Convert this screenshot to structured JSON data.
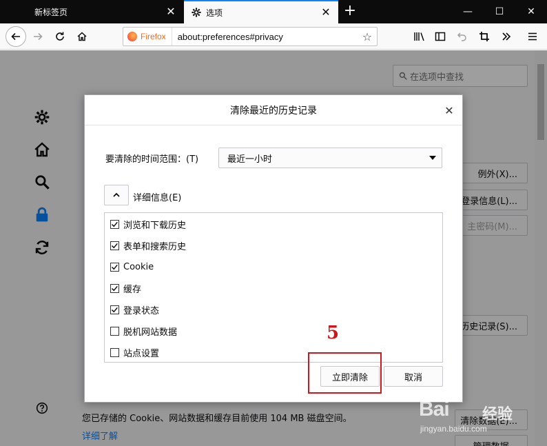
{
  "tabs": [
    {
      "title": "新标签页",
      "close": "✕"
    },
    {
      "title": "选项",
      "close": "✕"
    }
  ],
  "window_controls": {
    "minimize": "—",
    "maximize": "☐",
    "close": "✕"
  },
  "newtab": "+",
  "urlbar": {
    "identity": "Firefox",
    "url": "about:preferences#privacy"
  },
  "page": {
    "search_placeholder": "在选项中查找",
    "buttons": [
      "例外(X)...",
      "登录信息(L)...",
      "主密码(M)...",
      "历史记录(S)...",
      "清除数据(E)...",
      "管理数据..."
    ],
    "storage_text": "您已存储的 Cookie、网站数据和缓存目前使用 104 MB 磁盘空间。",
    "learn_more": "详细了解"
  },
  "dialog": {
    "title": "清除最近的历史记录",
    "close": "✕",
    "range_label": "要清除的时间范围：(T)",
    "range_value": "最近一小时",
    "details_label": "详细信息(E)",
    "items": [
      {
        "label": "浏览和下载历史",
        "checked": true
      },
      {
        "label": "表单和搜索历史",
        "checked": true
      },
      {
        "label": "Cookie",
        "checked": true
      },
      {
        "label": "缓存",
        "checked": true
      },
      {
        "label": "登录状态",
        "checked": true
      },
      {
        "label": "脱机网站数据",
        "checked": false
      },
      {
        "label": "站点设置",
        "checked": false
      }
    ],
    "clear_now": "立即清除",
    "cancel": "取消"
  },
  "annotation": {
    "step": "5",
    "color": "#d0161b"
  },
  "watermark": {
    "main": "Bai",
    "cn": "经验",
    "sub": "jingyan.baidu.com"
  },
  "colors": {
    "accent": "#0a84ff",
    "tabbar": "#0c0c0d"
  }
}
